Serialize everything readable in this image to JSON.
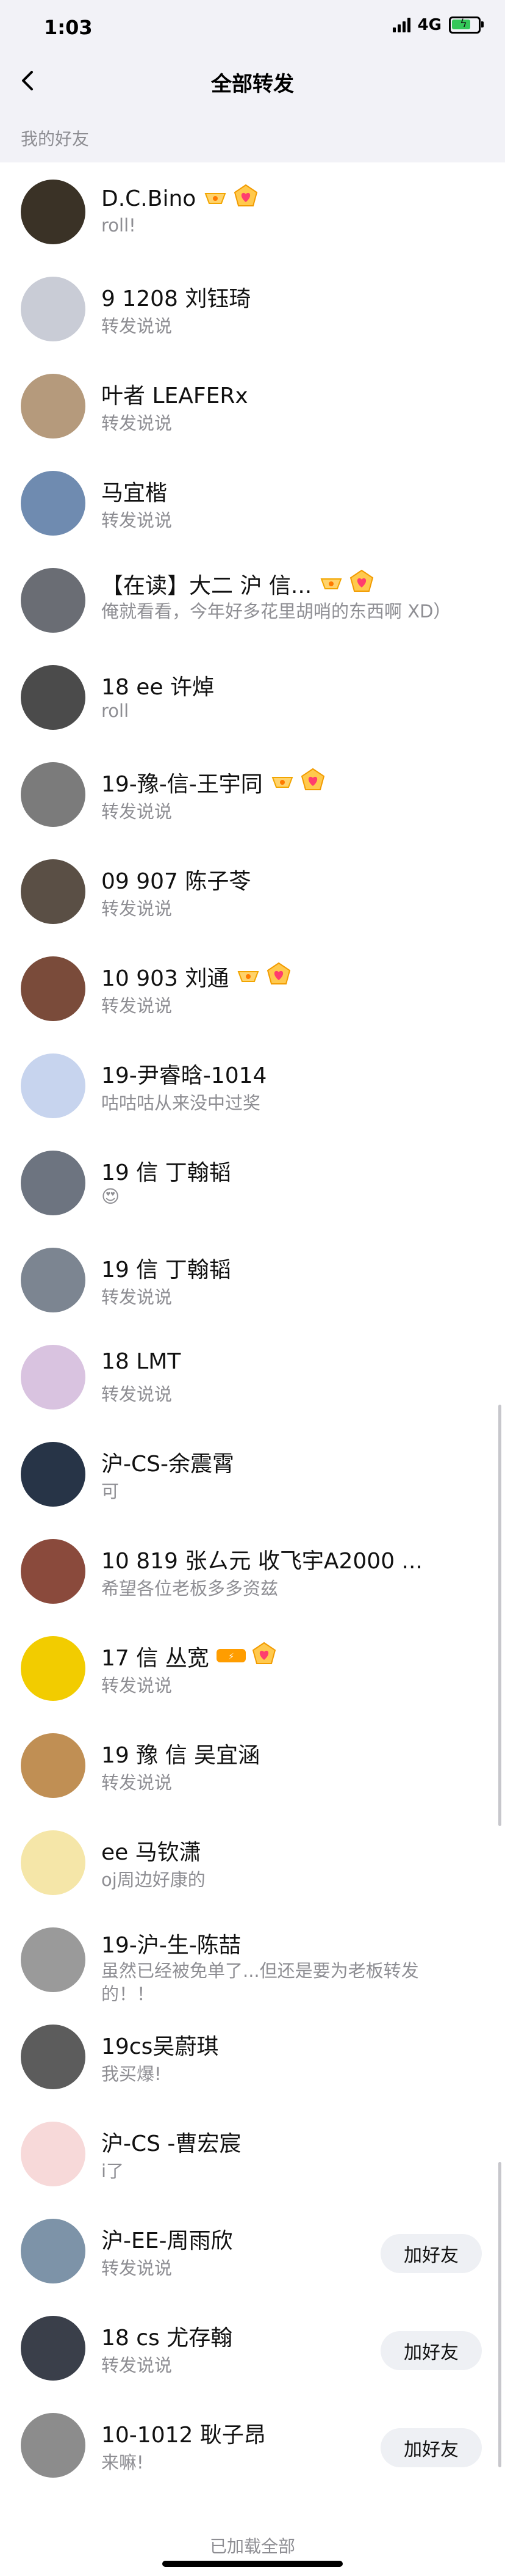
{
  "status": {
    "time": "1:03",
    "network": "4G"
  },
  "nav": {
    "title": "全部转发"
  },
  "section": {
    "title": "我的好友"
  },
  "rows": [
    {
      "name": "D.C.Bino",
      "sub": "roll!",
      "badges": "vip",
      "button": ""
    },
    {
      "name": "9 1208 刘钰琦",
      "sub": "转发说说",
      "badges": "",
      "button": ""
    },
    {
      "name": "叶者 LEAFERx",
      "sub": "转发说说",
      "badges": "",
      "button": ""
    },
    {
      "name": "马宜楷",
      "sub": "转发说说",
      "badges": "",
      "button": ""
    },
    {
      "name": "【在读】大二 沪 信...",
      "sub": "俺就看看，今年好多花里胡哨的东西啊 XD）",
      "badges": "vip",
      "button": ""
    },
    {
      "name": "18 ee 许焯",
      "sub": "roll",
      "badges": "",
      "button": ""
    },
    {
      "name": "19-豫-信-王宇同",
      "sub": "转发说说",
      "badges": "vip",
      "button": ""
    },
    {
      "name": "09 907 陈子苓",
      "sub": "转发说说",
      "badges": "",
      "button": ""
    },
    {
      "name": "10 903 刘通",
      "sub": "转发说说",
      "badges": "vip",
      "button": ""
    },
    {
      "name": "19-尹睿晗-1014",
      "sub": "咕咕咕从来没中过奖",
      "badges": "",
      "button": ""
    },
    {
      "name": "19 信 丁翰韬",
      "sub": "😍",
      "badges": "",
      "button": ""
    },
    {
      "name": "19 信 丁翰韬",
      "sub": "转发说说",
      "badges": "",
      "button": ""
    },
    {
      "name": "18 LMT",
      "sub": "转发说说",
      "badges": "",
      "button": ""
    },
    {
      "name": "沪-CS-余震霄",
      "sub": "可",
      "badges": "",
      "button": ""
    },
    {
      "name": "10 819 张ㄙ元 收飞宇A2000 ...",
      "sub": "希望各位老板多多资兹",
      "badges": "",
      "button": ""
    },
    {
      "name": "17 信 丛宽",
      "sub": "转发说说",
      "badges": "svip",
      "button": ""
    },
    {
      "name": "19 豫 信 吴宜涵",
      "sub": "转发说说",
      "badges": "",
      "button": ""
    },
    {
      "name": "ee 马钦潇",
      "sub": "oj周边好康的",
      "badges": "",
      "button": ""
    },
    {
      "name": "19-沪-生-陈喆",
      "sub": "虽然已经被免单了...但还是要为老板转发的！！",
      "badges": "",
      "button": ""
    },
    {
      "name": "19cs吴蔚琪",
      "sub": "我买爆!",
      "badges": "",
      "button": ""
    },
    {
      "name": "沪-CS -曹宏宸",
      "sub": "i了",
      "badges": "",
      "button": ""
    },
    {
      "name": "沪-EE-周雨欣",
      "sub": "转发说说",
      "badges": "",
      "button": "加好友"
    },
    {
      "name": "18 cs 尤存翰",
      "sub": "转发说说",
      "badges": "",
      "button": "加好友"
    },
    {
      "name": "10-1012 耿子昂",
      "sub": "来嘛!",
      "badges": "",
      "button": "加好友"
    }
  ],
  "avatar_colors": [
    "#3a3226",
    "#c9ccd6",
    "#b59a7c",
    "#6f8bb0",
    "#6a6d74",
    "#4b4b4b",
    "#7b7b7b",
    "#5a4f45",
    "#7a4b3a",
    "#c7d4ee",
    "#6d7480",
    "#7c8591",
    "#d9c3e0",
    "#273447",
    "#8a4a3c",
    "#f2cc00",
    "#c08f54",
    "#f5e6a8",
    "#9a9a9a",
    "#5c5c5c",
    "#f7d9d9",
    "#7d93a8",
    "#3a3f4a",
    "#8c8c8c"
  ],
  "footer": {
    "text": "已加载全部"
  }
}
